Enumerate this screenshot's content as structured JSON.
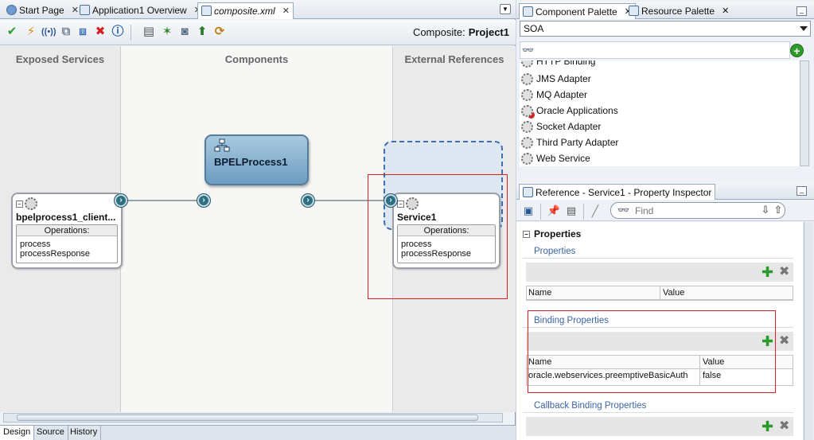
{
  "editor": {
    "tabs": [
      {
        "label": "Start Page",
        "close": "✕"
      },
      {
        "label": "Application1 Overview",
        "close": "✕"
      },
      {
        "label": "composite.xml",
        "close": "✕"
      }
    ],
    "composite_label": "Composite:",
    "composite_name": "Project1",
    "lanes": {
      "exposed": "Exposed Services",
      "components": "Components",
      "external": "External References"
    },
    "exposed_service": {
      "title": "bpelprocess1_client...",
      "ops_header": "Operations:",
      "ops": [
        "process",
        "processResponse"
      ]
    },
    "component": {
      "title": "BPELProcess1"
    },
    "reference": {
      "title": "Service1",
      "ops_header": "Operations:",
      "ops": [
        "process",
        "processResponse"
      ]
    },
    "bottom_tabs": [
      "Design",
      "Source",
      "History"
    ]
  },
  "palette": {
    "tabs": [
      {
        "label": "Component Palette",
        "close": "✕"
      },
      {
        "label": "Resource Palette",
        "close": "✕"
      }
    ],
    "category": "SOA",
    "items": [
      {
        "label": "HTTP Binding"
      },
      {
        "label": "JMS Adapter"
      },
      {
        "label": "MQ Adapter"
      },
      {
        "label": "Oracle Applications"
      },
      {
        "label": "Socket Adapter"
      },
      {
        "label": "Third Party Adapter"
      },
      {
        "label": "Web Service"
      }
    ]
  },
  "inspector": {
    "tab_label": "Reference - Service1 - Property Inspector",
    "find_placeholder": "Find",
    "section": "Properties",
    "properties": {
      "title": "Properties",
      "col_name": "Name",
      "col_value": "Value"
    },
    "binding": {
      "title": "Binding Properties",
      "col_name": "Name",
      "col_value": "Value",
      "rows": [
        {
          "name": "oracle.webservices.preemptiveBasicAuth",
          "value": "false"
        }
      ]
    },
    "callback": {
      "title": "Callback Binding Properties"
    }
  },
  "colors": {
    "accent": "#2d6f83",
    "bpel_fill": "#6d9cc0",
    "highlight_box": "#d92020",
    "add_green": "#2a9b2a"
  }
}
